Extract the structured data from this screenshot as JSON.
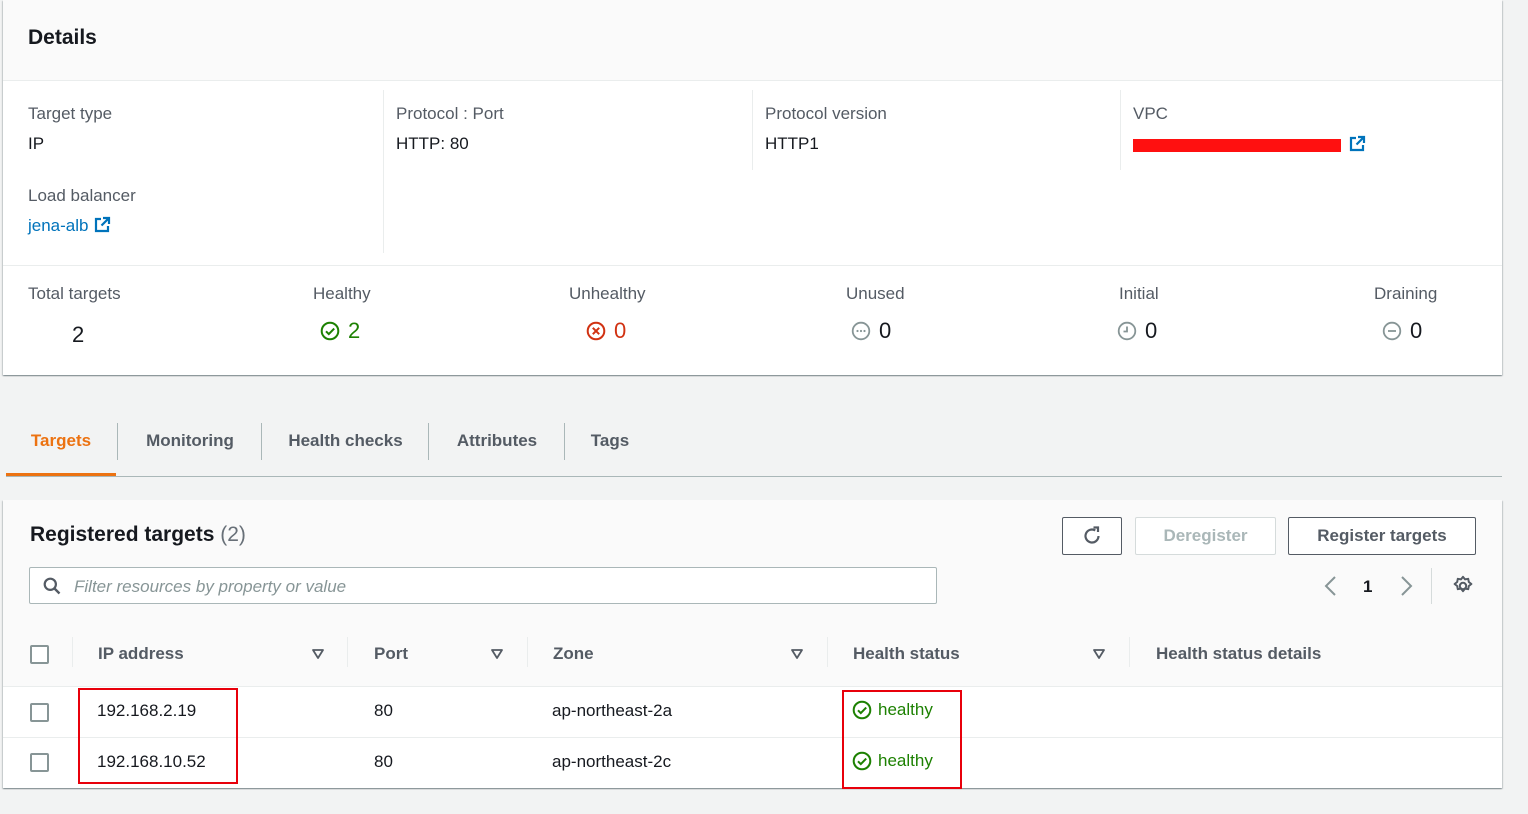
{
  "details": {
    "title": "Details",
    "target_type": {
      "label": "Target type",
      "value": "IP"
    },
    "load_balancer": {
      "label": "Load balancer",
      "value": "jena-alb"
    },
    "protocol_port": {
      "label": "Protocol : Port",
      "value": "HTTP: 80"
    },
    "protocol_version": {
      "label": "Protocol version",
      "value": "HTTP1"
    },
    "vpc": {
      "label": "VPC"
    },
    "counts": {
      "total": {
        "label": "Total targets",
        "value": "2"
      },
      "healthy": {
        "label": "Healthy",
        "value": "2"
      },
      "unhealthy": {
        "label": "Unhealthy",
        "value": "0"
      },
      "unused": {
        "label": "Unused",
        "value": "0"
      },
      "initial": {
        "label": "Initial",
        "value": "0"
      },
      "draining": {
        "label": "Draining",
        "value": "0"
      }
    }
  },
  "tabs": [
    {
      "label": "Targets",
      "active": true
    },
    {
      "label": "Monitoring"
    },
    {
      "label": "Health checks"
    },
    {
      "label": "Attributes"
    },
    {
      "label": "Tags"
    }
  ],
  "registered": {
    "title": "Registered targets",
    "count": "(2)",
    "deregister_label": "Deregister",
    "register_label": "Register targets",
    "search_placeholder": "Filter resources by property or value",
    "page": "1",
    "columns": [
      "IP address",
      "Port",
      "Zone",
      "Health status",
      "Health status details"
    ],
    "rows": [
      {
        "ip": "192.168.2.19",
        "port": "80",
        "zone": "ap-northeast-2a",
        "health": "healthy",
        "details": ""
      },
      {
        "ip": "192.168.10.52",
        "port": "80",
        "zone": "ap-northeast-2c",
        "health": "healthy",
        "details": ""
      }
    ]
  },
  "colors": {
    "accent": "#ec7211",
    "link": "#0073bb",
    "healthy": "#1d8102",
    "unhealthy": "#d13212",
    "annotation": "#e8000b",
    "redaction": "#ff1010"
  },
  "icons": [
    "external-link-icon",
    "status-healthy-icon",
    "status-unhealthy-icon",
    "status-unused-icon",
    "status-initial-icon",
    "status-draining-icon",
    "refresh-icon",
    "search-icon",
    "chevron-left-icon",
    "chevron-right-icon",
    "gear-icon",
    "sort-down-icon"
  ]
}
